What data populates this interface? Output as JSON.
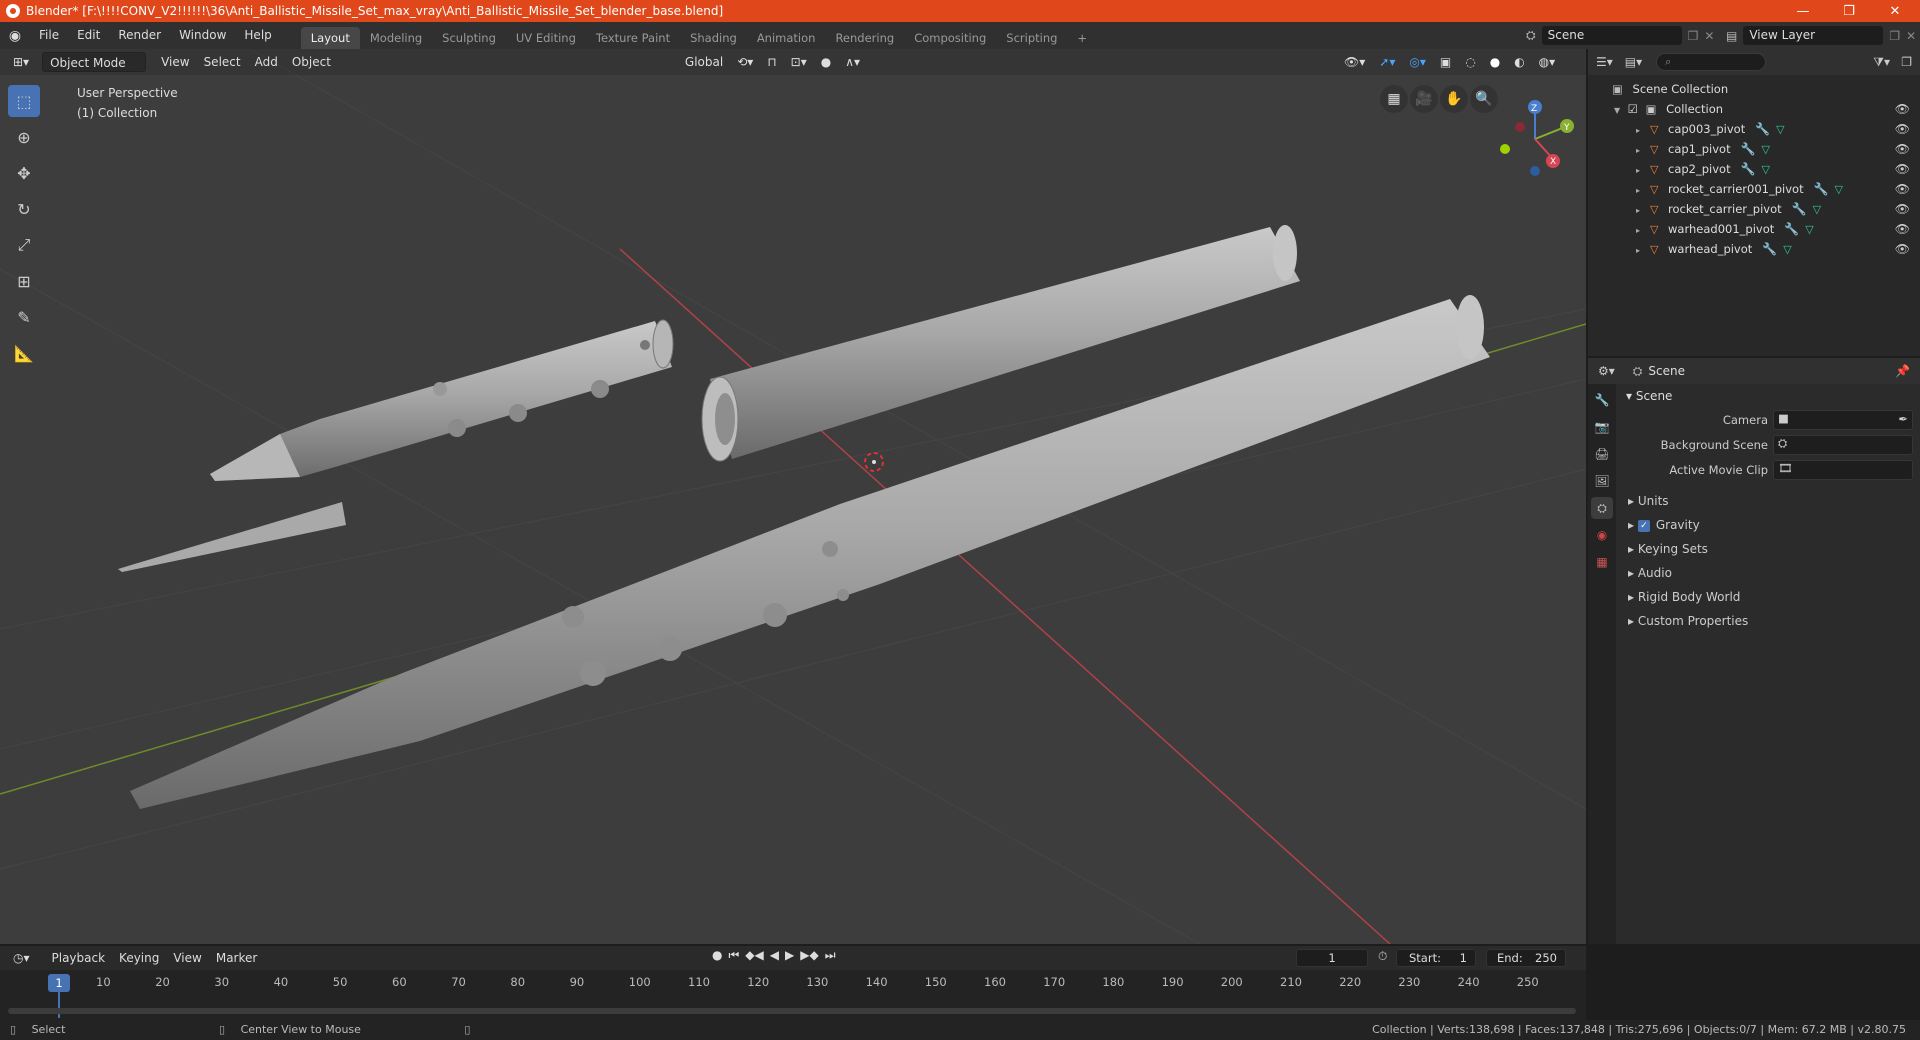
{
  "window": {
    "title": "Blender* [F:\\!!!!CONV_V2!!!!!!\\36\\Anti_Ballistic_Missile_Set_max_vray\\Anti_Ballistic_Missile_Set_blender_base.blend]",
    "minimize": "—",
    "restore": "❐",
    "close": "✕"
  },
  "menus": [
    "File",
    "Edit",
    "Render",
    "Window",
    "Help"
  ],
  "workspaces": [
    "Layout",
    "Modeling",
    "Sculpting",
    "UV Editing",
    "Texture Paint",
    "Shading",
    "Animation",
    "Rendering",
    "Compositing",
    "Scripting"
  ],
  "workspace_add": "+",
  "active_workspace": "Layout",
  "scene_selector": {
    "value": "Scene"
  },
  "view_layer": {
    "value": "View Layer"
  },
  "viewport": {
    "mode": "Object Mode",
    "menus": [
      "View",
      "Select",
      "Add",
      "Object"
    ],
    "transform_orientation": "Global",
    "info_line1": "User Perspective",
    "info_line2": "(1) Collection",
    "gizmo": {
      "z": "Z",
      "y": "Y",
      "x": "X"
    }
  },
  "outliner": {
    "search_placeholder": "",
    "root": "Scene Collection",
    "collection": "Collection",
    "objects": [
      "cap003_pivot",
      "cap1_pivot",
      "cap2_pivot",
      "rocket_carrier001_pivot",
      "rocket_carrier_pivot",
      "warhead001_pivot",
      "warhead_pivot"
    ]
  },
  "properties": {
    "header": "Scene",
    "panel": "Scene",
    "fields": [
      {
        "label": "Camera",
        "value": ""
      },
      {
        "label": "Background Scene",
        "value": ""
      },
      {
        "label": "Active Movie Clip",
        "value": ""
      }
    ],
    "subpanels": [
      "Units",
      "Gravity",
      "Keying Sets",
      "Audio",
      "Rigid Body World",
      "Custom Properties"
    ],
    "gravity_checked": true
  },
  "timeline": {
    "menus": [
      "Playback",
      "Keying",
      "View",
      "Marker"
    ],
    "current_frame": "1",
    "start_label": "Start:",
    "start": "1",
    "end_label": "End:",
    "end": "250",
    "ticks": [
      "1",
      "10",
      "20",
      "30",
      "40",
      "50",
      "60",
      "70",
      "80",
      "90",
      "100",
      "110",
      "120",
      "130",
      "140",
      "150",
      "160",
      "170",
      "180",
      "190",
      "200",
      "210",
      "220",
      "230",
      "240",
      "250"
    ]
  },
  "status": {
    "left1": "Select",
    "left2": "Center View to Mouse",
    "right": "Collection | Verts:138,698 | Faces:137,848 | Tris:275,696 | Objects:0/7 | Mem: 67.2 MB | v2.80.75"
  },
  "colors": {
    "accent": "#4772b3",
    "titlebar": "#e0471a",
    "x_axis": "#c8414f",
    "y_axis": "#7a9a2a"
  }
}
